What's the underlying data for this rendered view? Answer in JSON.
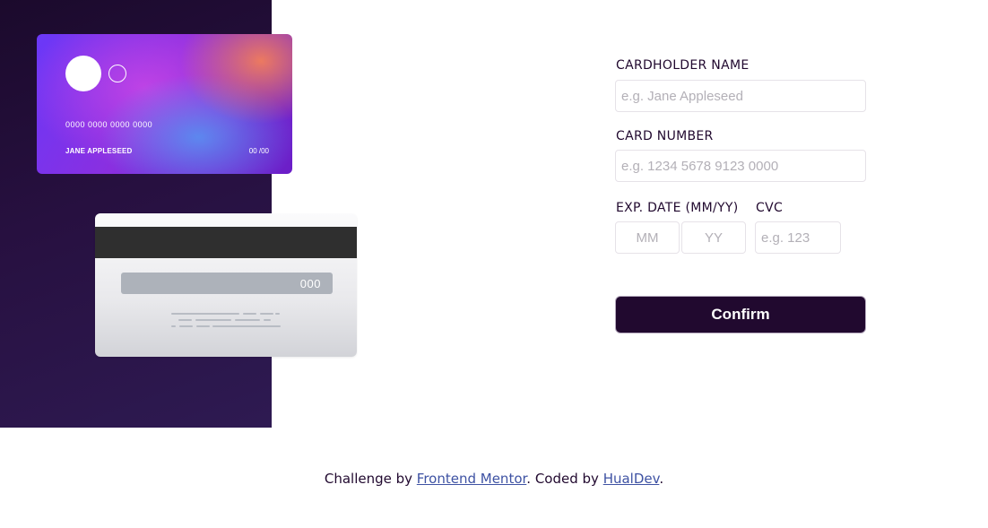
{
  "card_front": {
    "number": "0000 0000 0000 0000",
    "name": "JANE APPLESEED",
    "expiry": "00 /00"
  },
  "card_back": {
    "cvc": "000"
  },
  "form": {
    "name_label": "CARDHOLDER NAME",
    "name_placeholder": "e.g. Jane Appleseed",
    "number_label": "CARD NUMBER",
    "number_placeholder": "e.g. 1234 5678 9123 0000",
    "exp_label": "EXP. DATE (MM/YY)",
    "month_placeholder": "MM",
    "year_placeholder": "YY",
    "cvc_label": "CVC",
    "cvc_placeholder": "e.g. 123",
    "confirm_label": "Confirm"
  },
  "footer": {
    "prefix": "Challenge by ",
    "link1": "Frontend Mentor",
    "middle": ". Coded by ",
    "link2": "HualDev",
    "suffix": "."
  },
  "colors": {
    "panel_dark": "#21092f",
    "accent_link": "#3e52a3",
    "input_border": "#e6e2e8"
  }
}
